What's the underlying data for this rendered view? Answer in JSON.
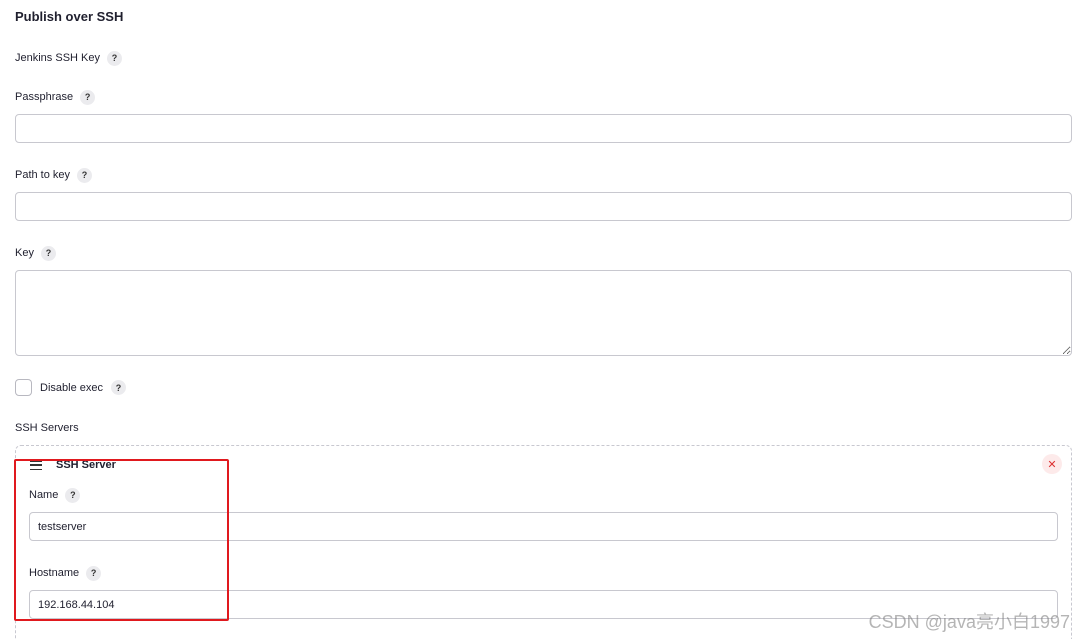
{
  "section_title": "Publish over SSH",
  "fields": {
    "jenkins_ssh_key": {
      "label": "Jenkins SSH Key"
    },
    "passphrase": {
      "label": "Passphrase",
      "value": ""
    },
    "path_to_key": {
      "label": "Path to key",
      "value": ""
    },
    "key": {
      "label": "Key",
      "value": ""
    },
    "disable_exec": {
      "label": "Disable exec",
      "checked": false
    }
  },
  "help_glyph": "?",
  "ssh_servers": {
    "label": "SSH Servers",
    "server": {
      "title": "SSH Server",
      "close_glyph": "✕",
      "name": {
        "label": "Name",
        "value": "testserver"
      },
      "hostname": {
        "label": "Hostname",
        "value": "192.168.44.104"
      }
    }
  },
  "watermark": "CSDN @java亮小白1997",
  "colors": {
    "highlight": "#e0191e",
    "close": "#dd3333"
  }
}
